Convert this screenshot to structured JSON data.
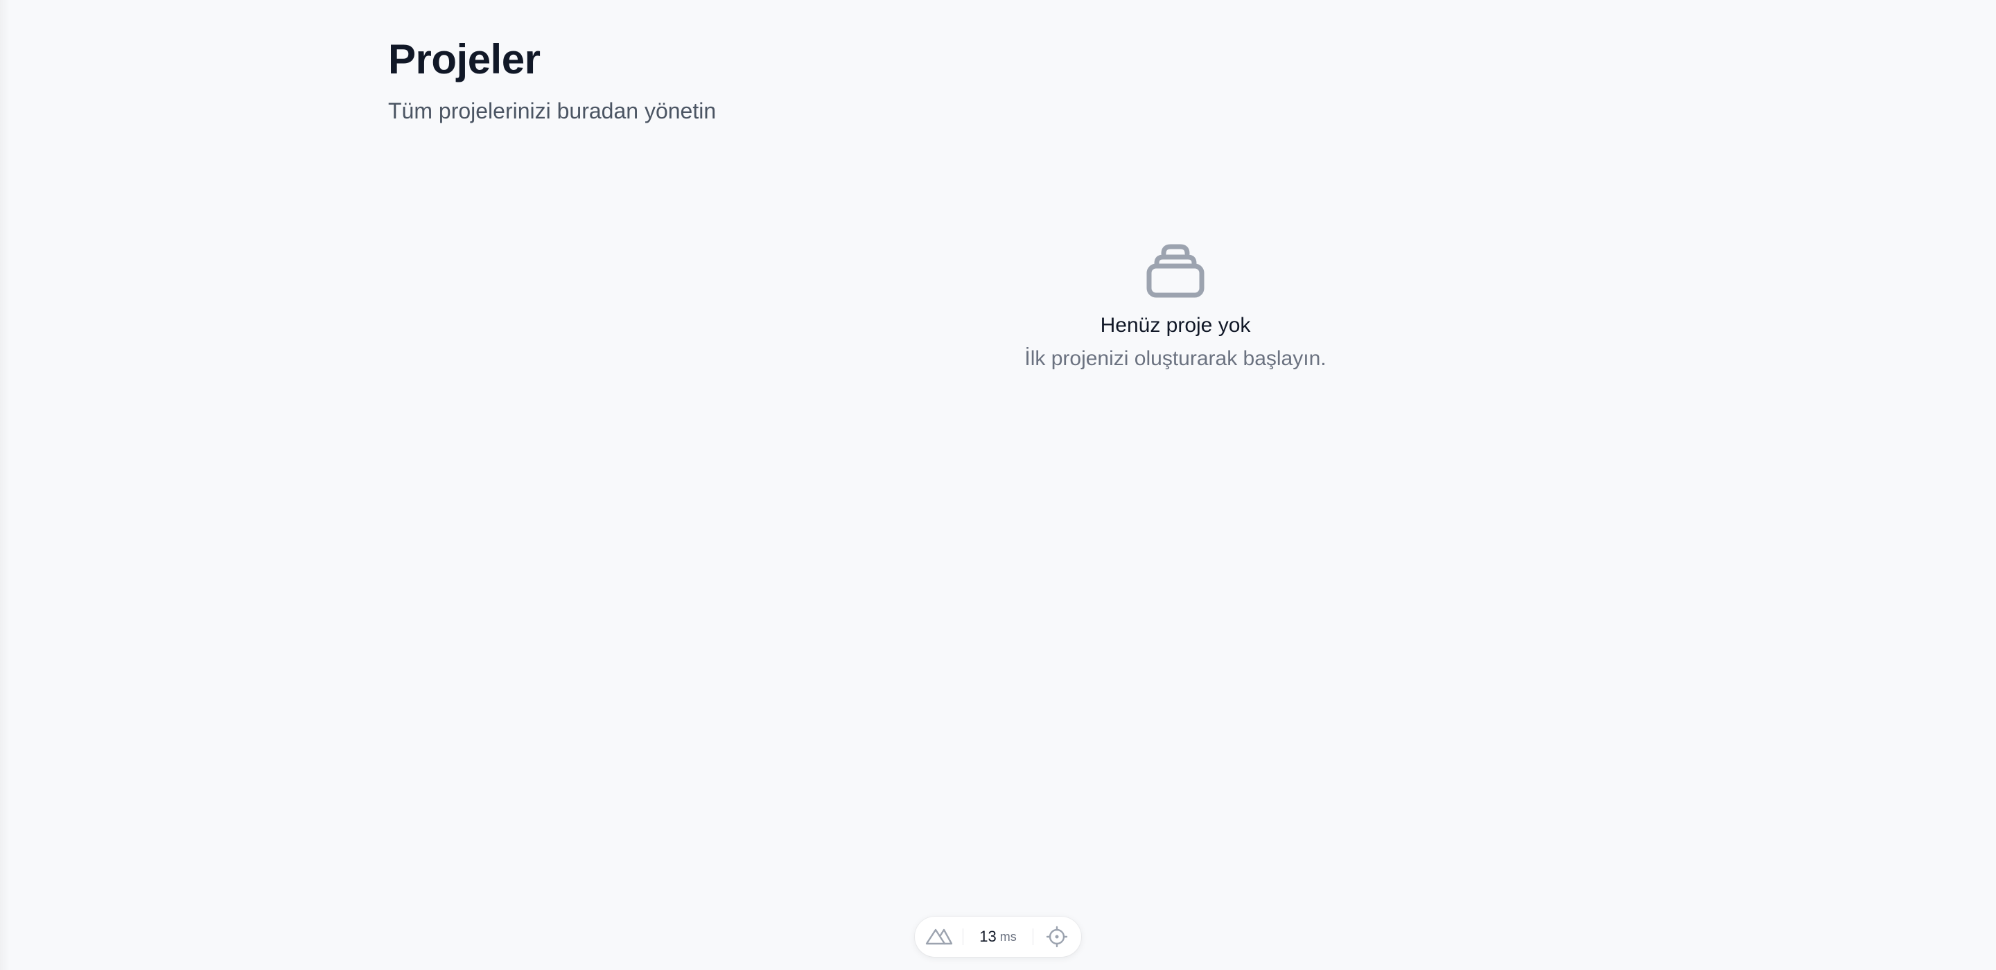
{
  "header": {
    "title": "Projeler",
    "subtitle": "Tüm projelerinizi buradan yönetin"
  },
  "empty_state": {
    "icon": "inbox-stack-icon",
    "title": "Henüz proje yok",
    "description": "İlk projenizi oluşturarak başlayın."
  },
  "devtools_bar": {
    "logo_icon": "nuxt-logo-icon",
    "time_value": "13",
    "time_unit": "ms",
    "inspect_icon": "crosshair-icon"
  },
  "colors": {
    "background": "#f8f9fb",
    "title": "#111827",
    "subtitle": "#4b5563",
    "muted": "#6b7280",
    "icon": "#9ca3af"
  }
}
